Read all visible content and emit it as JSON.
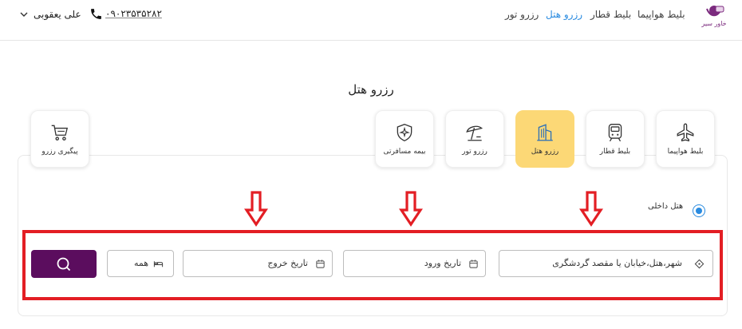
{
  "header": {
    "logo_text": "خاور سیر",
    "nav": [
      "بلیط هواپیما",
      "بلیط قطار",
      "رزرو هتل",
      "رزرو تور"
    ],
    "active_nav": "رزرو هتل",
    "phone": "۰۹۰۲۳۵۳۵۲۸۲",
    "username": "علی یعقوبی"
  },
  "page_title": "رزرو هتل",
  "tabs": [
    {
      "label": "بلیط هواپیما",
      "icon": "airplane-icon"
    },
    {
      "label": "بلیط قطار",
      "icon": "train-icon"
    },
    {
      "label": "رزرو هتل",
      "icon": "hotel-icon",
      "active": true
    },
    {
      "label": "رزرو تور",
      "icon": "umbrella-icon"
    },
    {
      "label": "بیمه مسافرتی",
      "icon": "insurance-shield-icon"
    },
    {
      "label": "پیگیری رزرو",
      "icon": "cart-icon"
    }
  ],
  "search": {
    "radio_label": "هتل داخلی",
    "destination_placeholder": "شهر،هتل،خیابان یا مقصد گردشگری",
    "checkin_placeholder": "تاریخ ورود",
    "checkout_placeholder": "تاریخ خروج",
    "rooms_label": "همه"
  },
  "colors": {
    "accent": "#5b0d5e",
    "active_tab": "#fcd876",
    "link_active": "#2a8be0",
    "highlight_red": "#e31e24"
  }
}
